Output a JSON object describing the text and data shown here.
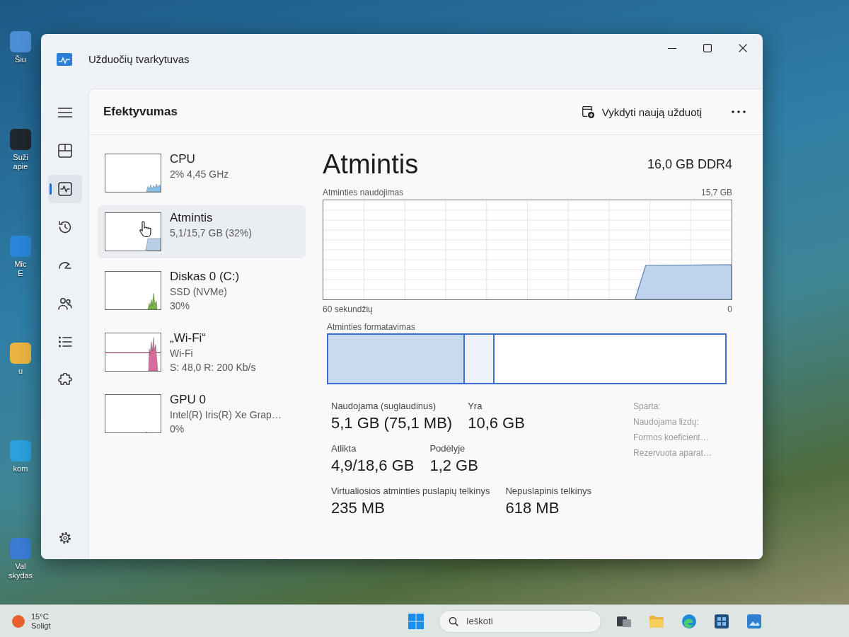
{
  "window": {
    "title": "Užduočių tvarkytuvas"
  },
  "desktop_icons": [
    {
      "lines": [
        "Šiu"
      ],
      "color": "#4d8fd6"
    },
    {
      "lines": [
        "Suži",
        "apie"
      ],
      "color": "#20262e"
    },
    {
      "lines": [
        "Mic",
        "E"
      ],
      "color": "#2a86d8"
    },
    {
      "lines": [
        "u"
      ],
      "color": "#e9b440"
    },
    {
      "lines": [
        "kom"
      ],
      "color": "#2ba0dc"
    },
    {
      "lines": [
        "Val",
        "skydas"
      ],
      "color": "#3a7cd4"
    }
  ],
  "nav": {
    "items": [
      {
        "kind": "processes",
        "selected": false
      },
      {
        "kind": "performance",
        "selected": true
      },
      {
        "kind": "app_history",
        "selected": false
      },
      {
        "kind": "startup",
        "selected": false
      },
      {
        "kind": "users",
        "selected": false
      },
      {
        "kind": "details",
        "selected": false
      },
      {
        "kind": "services",
        "selected": false
      }
    ]
  },
  "header": {
    "title": "Efektyvumas",
    "run_task_button": "Vykdyti naują užduotį"
  },
  "resources": [
    {
      "kind": "cpu",
      "title": "CPU",
      "lines": [
        "2% 4,45 GHz"
      ],
      "color": "#8cc0e6",
      "selected": false
    },
    {
      "kind": "memory",
      "title": "Atmintis",
      "lines": [
        "5,1/15,7 GB (32%)"
      ],
      "color": "#b7cde8",
      "selected": true
    },
    {
      "kind": "disk",
      "title": "Diskas 0 (C:)",
      "lines": [
        "SSD (NVMe)",
        "30%"
      ],
      "color": "#7ab648",
      "selected": false
    },
    {
      "kind": "network",
      "title": "„Wi-Fi“",
      "lines": [
        "Wi-Fi",
        "S: 48,0 R: 200 Kb/s"
      ],
      "color": "#d96c9c",
      "selected": false
    },
    {
      "kind": "gpu",
      "title": "GPU 0",
      "lines": [
        "Intel(R) Iris(R) Xe Grap…",
        "0%"
      ],
      "selected": false
    }
  ],
  "detail": {
    "title": "Atmintis",
    "capacity": "16,0 GB DDR4",
    "memory_usage": {
      "title": "Atminties naudojimas",
      "max_label": "15,7 GB",
      "span_label": "60 sekundžių",
      "end_label": "0"
    },
    "composition": {
      "label": "Atminties formatavimas"
    },
    "stats": [
      [
        {
          "label": "Naudojama (suglaudinus)",
          "value": "5,1 GB (75,1 MB)"
        },
        {
          "label": "Yra",
          "value": "10,6 GB"
        }
      ],
      [
        {
          "label": "Atlikta",
          "value": "4,9/18,6 GB"
        },
        {
          "label": "Podėlyje",
          "value": "1,2 GB"
        }
      ],
      [
        {
          "label": "Virtualiosios atminties puslapių telkinys",
          "value": "235 MB"
        },
        {
          "label": "Nepuslapinis telkinys",
          "value": "618 MB"
        }
      ]
    ],
    "hardware_labels": [
      "Sparta:",
      "Naudojama lizdų:",
      "Formos koeficient…",
      "Rezervuota aparat…"
    ]
  },
  "taskbar": {
    "weather": {
      "temperature": "15°C",
      "condition": "Soligt"
    },
    "search": {
      "placeholder": "Ieškoti"
    }
  }
}
